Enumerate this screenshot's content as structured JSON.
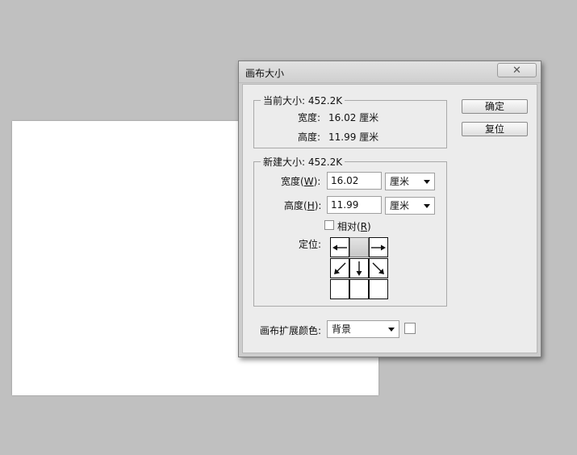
{
  "dialog": {
    "title": "画布大小",
    "close_glyph": "✕"
  },
  "current_size": {
    "legend": "当前大小: 452.2K",
    "width_label": "宽度:",
    "width_value": "16.02 厘米",
    "height_label": "高度:",
    "height_value": "11.99 厘米"
  },
  "new_size": {
    "legend": "新建大小: 452.2K",
    "width_label_pre": "宽度(",
    "width_label_key": "W",
    "width_label_post": "):",
    "width_value": "16.02",
    "width_unit": "厘米",
    "height_label_pre": "高度(",
    "height_label_key": "H",
    "height_label_post": "):",
    "height_value": "11.99",
    "height_unit": "厘米",
    "relative_label_pre": "相对(",
    "relative_label_key": "R",
    "relative_label_post": ")",
    "relative_checked": false,
    "anchor_label": "定位:"
  },
  "buttons": {
    "ok": "确定",
    "reset": "复位"
  },
  "extension": {
    "label": "画布扩展颜色:",
    "value": "背景",
    "swatch_color": "#ffffff"
  },
  "icons": {
    "anchor_left": "arrow-left-icon",
    "anchor_right": "arrow-right-icon",
    "anchor_down_left": "arrow-down-left-icon",
    "anchor_down": "arrow-down-icon",
    "anchor_down_right": "arrow-down-right-icon",
    "close": "close-icon",
    "dropdown": "chevron-down-icon"
  }
}
